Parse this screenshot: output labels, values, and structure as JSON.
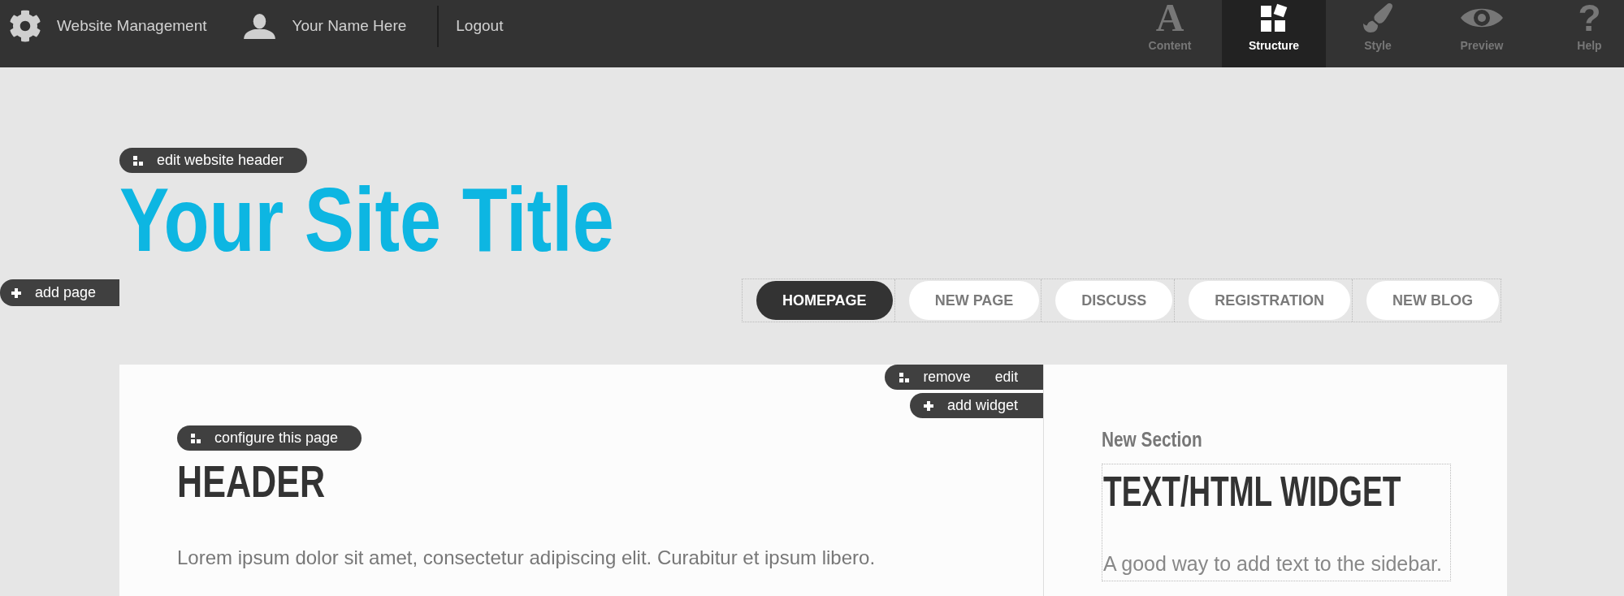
{
  "top_bar": {
    "site_menu": "Website Management",
    "user_name": "Your Name Here",
    "logout": "Logout",
    "tabs": [
      {
        "label": "Content",
        "glyph": "A",
        "selected": false
      },
      {
        "label": "Structure",
        "selected": true
      },
      {
        "label": "Style",
        "selected": false
      },
      {
        "label": "Preview",
        "selected": false
      },
      {
        "label": "Help",
        "glyph": "?",
        "selected": false
      }
    ]
  },
  "header": {
    "edit_button": "edit website header",
    "site_title": "Your Site Title",
    "add_page_button": "add page"
  },
  "nav_tabs": [
    {
      "label": "HOMEPAGE",
      "selected": true
    },
    {
      "label": "NEW PAGE",
      "selected": false
    },
    {
      "label": "DISCUSS",
      "selected": false
    },
    {
      "label": "REGISTRATION",
      "selected": false
    },
    {
      "label": "NEW BLOG",
      "selected": false
    }
  ],
  "content": {
    "toolbar": {
      "remove": "remove",
      "edit": "edit"
    },
    "add_widget_button": "add widget",
    "configure_button": "configure this page",
    "heading": "HEADER",
    "paragraph": "Lorem ipsum dolor sit amet, consectetur adipiscing elit. Curabitur et ipsum libero."
  },
  "sidebar": {
    "section_title": "New Section",
    "widget": {
      "title": "TEXT/HTML WIDGET",
      "text": "A good way to add text to the sidebar."
    }
  }
}
